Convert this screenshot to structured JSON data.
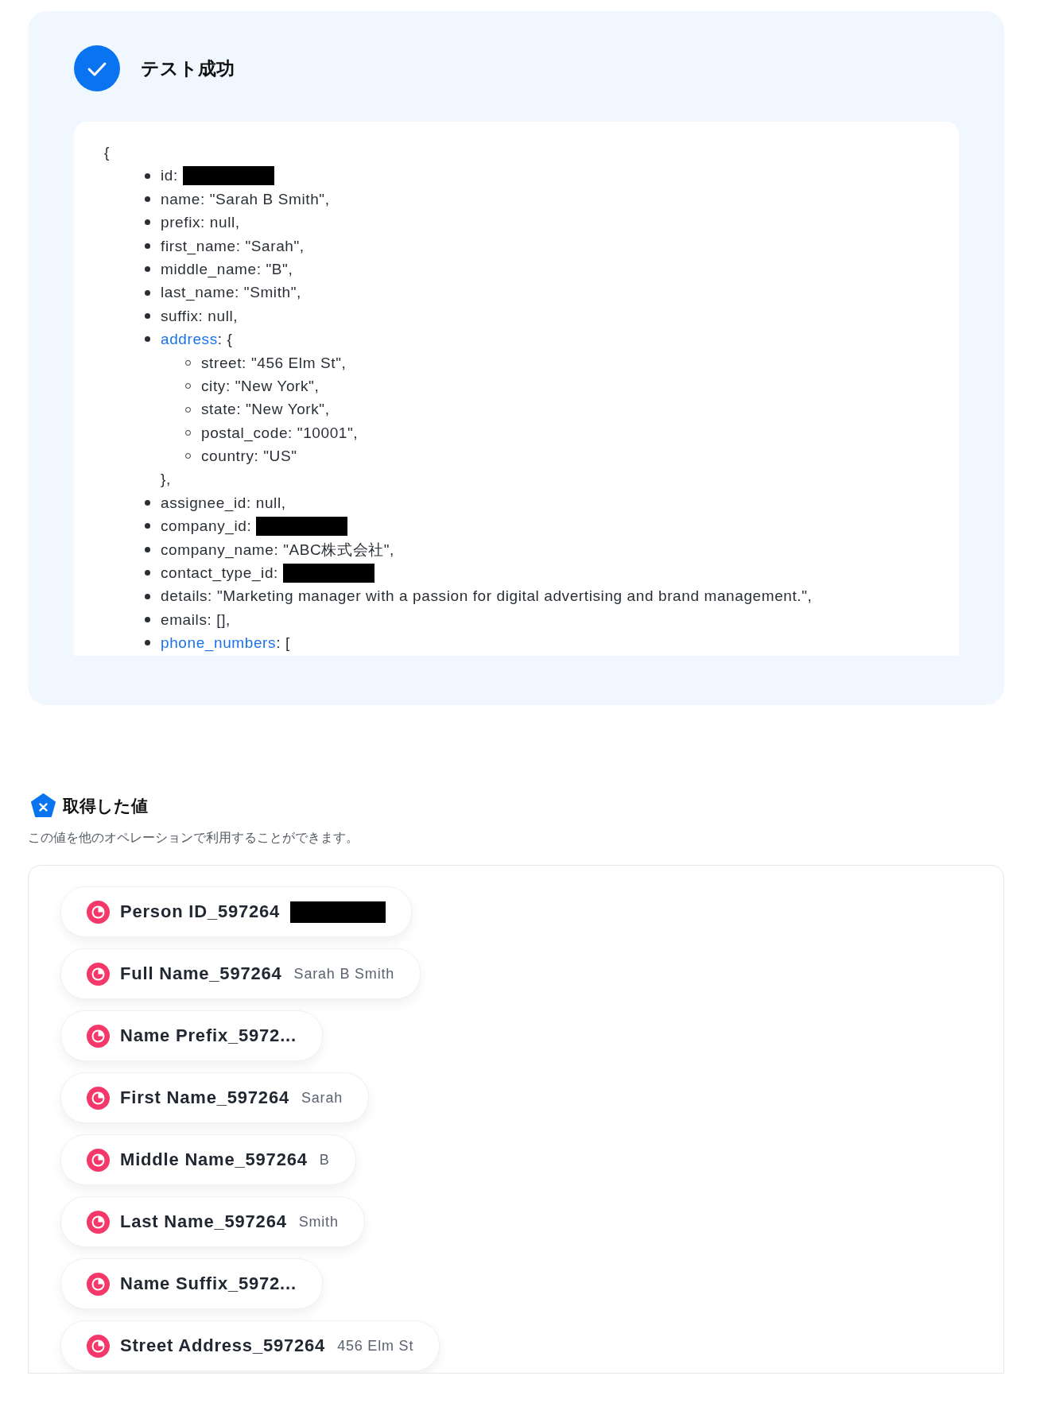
{
  "result_panel": {
    "title": "テスト成功",
    "code": {
      "open": "{",
      "lines": [
        {
          "kind": "redacted",
          "text": "id:"
        },
        {
          "kind": "text",
          "text": "name: \"Sarah B Smith\","
        },
        {
          "kind": "text",
          "text": "prefix: null,"
        },
        {
          "kind": "text",
          "text": "first_name: \"Sarah\","
        },
        {
          "kind": "text",
          "text": "middle_name: \"B\","
        },
        {
          "kind": "text",
          "text": "last_name: \"Smith\","
        },
        {
          "kind": "text",
          "text": "suffix: null,"
        },
        {
          "kind": "link",
          "key": "address",
          "text": ": {",
          "close": "},",
          "children": [
            {
              "kind": "text",
              "text": "street: \"456 Elm St\","
            },
            {
              "kind": "text",
              "text": "city: \"New York\","
            },
            {
              "kind": "text",
              "text": "state: \"New York\","
            },
            {
              "kind": "text",
              "text": "postal_code: \"10001\","
            },
            {
              "kind": "text",
              "text": "country: \"US\""
            }
          ]
        },
        {
          "kind": "text",
          "text": "assignee_id: null,"
        },
        {
          "kind": "redacted",
          "text": "company_id:"
        },
        {
          "kind": "text",
          "text": "company_name: \"ABC株式会社\","
        },
        {
          "kind": "redacted",
          "text": "contact_type_id:"
        },
        {
          "kind": "text",
          "text": "details: \"Marketing manager with a passion for digital advertising and brand management.\","
        },
        {
          "kind": "text",
          "text": "emails: [],"
        },
        {
          "kind": "link",
          "key": "phone_numbers",
          "text": ": ["
        }
      ]
    }
  },
  "values_section": {
    "title": "取得した値",
    "description": "この値を他のオペレーションで利用することができます。",
    "chips": [
      {
        "kind": "redacted",
        "label": "Person ID_597264"
      },
      {
        "kind": "value",
        "label": "Full Name_597264",
        "value": "Sarah B Smith"
      },
      {
        "kind": "label",
        "label": "Name Prefix_5972..."
      },
      {
        "kind": "value",
        "label": "First Name_597264",
        "value": "Sarah"
      },
      {
        "kind": "value",
        "label": "Middle Name_597264",
        "value": "B"
      },
      {
        "kind": "value",
        "label": "Last Name_597264",
        "value": "Smith"
      },
      {
        "kind": "label",
        "label": "Name Suffix_5972..."
      },
      {
        "kind": "value",
        "label": "Street Address_597264",
        "value": "456 Elm St"
      }
    ]
  }
}
